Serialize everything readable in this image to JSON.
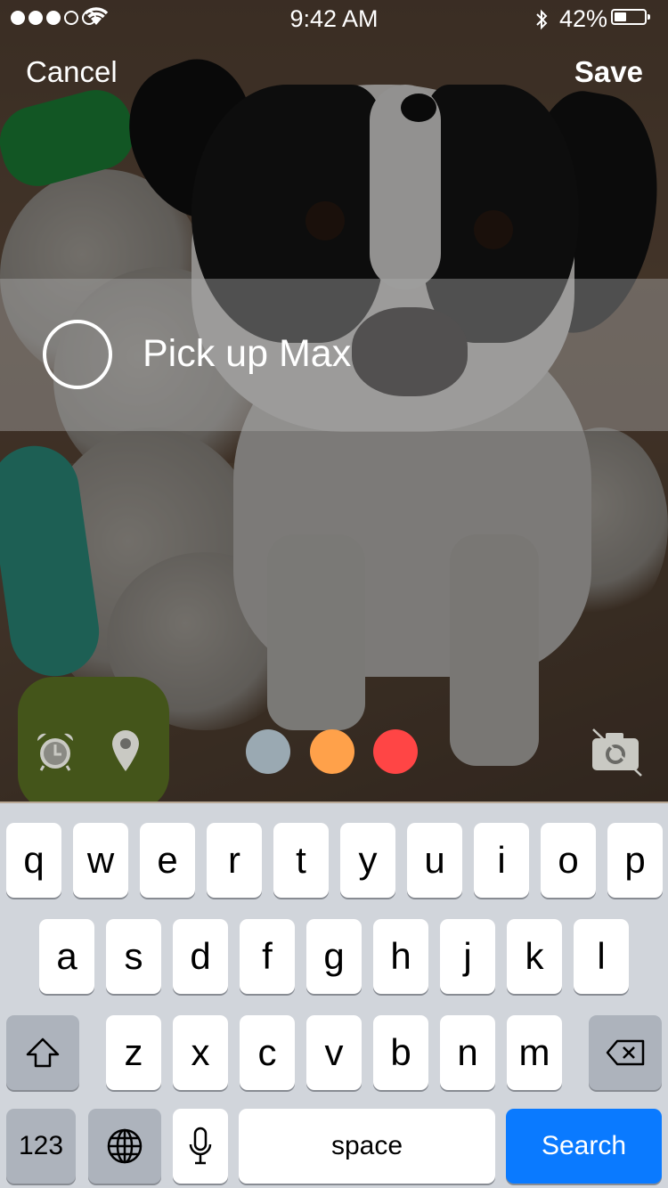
{
  "status_bar": {
    "time": "9:42 AM",
    "battery_percent": "42%",
    "battery_level": 0.42,
    "signal_bars_filled": 3,
    "signal_bars_total": 5,
    "icons": [
      "signal-icon",
      "wifi-icon",
      "bluetooth-icon",
      "battery-icon"
    ]
  },
  "nav": {
    "cancel_label": "Cancel",
    "save_label": "Save"
  },
  "task": {
    "title": "Pick up Max",
    "completed": false
  },
  "tools": {
    "icons": [
      "alarm-icon",
      "location-pin-icon",
      "camera-off-icon"
    ],
    "colors": [
      "#9aa9b2",
      "#ffa14a",
      "#ff4545"
    ]
  },
  "keyboard": {
    "row1": [
      "q",
      "w",
      "e",
      "r",
      "t",
      "y",
      "u",
      "i",
      "o",
      "p"
    ],
    "row2": [
      "a",
      "s",
      "d",
      "f",
      "g",
      "h",
      "j",
      "k",
      "l"
    ],
    "row3": [
      "z",
      "x",
      "c",
      "v",
      "b",
      "n",
      "m"
    ],
    "numbers_label": "123",
    "space_label": "space",
    "search_label": "Search"
  }
}
